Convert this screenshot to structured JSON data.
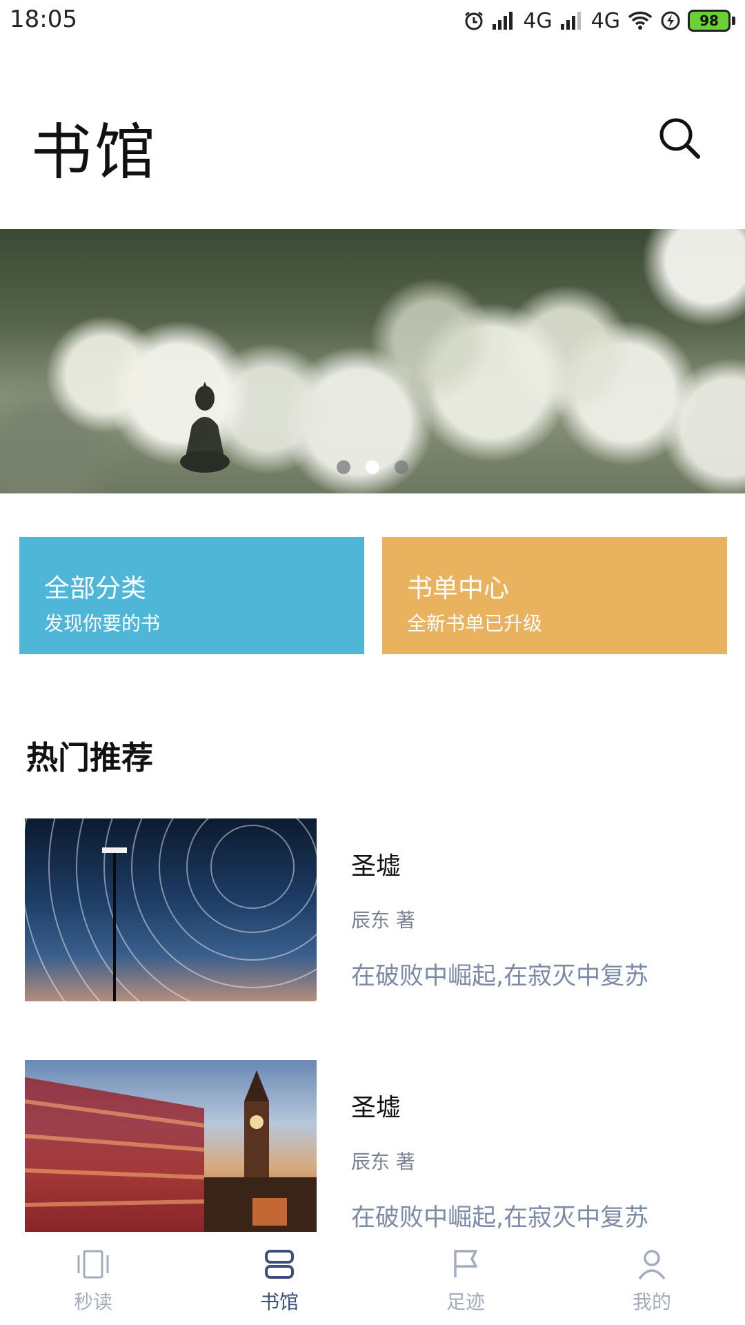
{
  "status_bar": {
    "time": "18:05",
    "network_1": "4G",
    "network_2": "4G",
    "battery": "98"
  },
  "header": {
    "title": "书馆"
  },
  "categories": [
    {
      "title": "全部分类",
      "subtitle": "发现你要的书"
    },
    {
      "title": "书单中心",
      "subtitle": "全新书单已升级"
    }
  ],
  "section": {
    "title": "热门推荐"
  },
  "books": [
    {
      "title": "圣墟",
      "author": "辰东 著",
      "desc": "在破败中崛起,在寂灭中复苏"
    },
    {
      "title": "圣墟",
      "author": "辰东 著",
      "desc": "在破败中崛起,在寂灭中复苏"
    }
  ],
  "nav": [
    {
      "label": "秒读",
      "icon": "cards-icon"
    },
    {
      "label": "书馆",
      "icon": "library-icon"
    },
    {
      "label": "足迹",
      "icon": "flag-icon"
    },
    {
      "label": "我的",
      "icon": "person-icon"
    }
  ],
  "colors": {
    "blue_card": "#4fb6d8",
    "orange_card": "#e8b25f",
    "nav_active": "#3a4f7d",
    "nav_inactive": "#a3acbd"
  }
}
